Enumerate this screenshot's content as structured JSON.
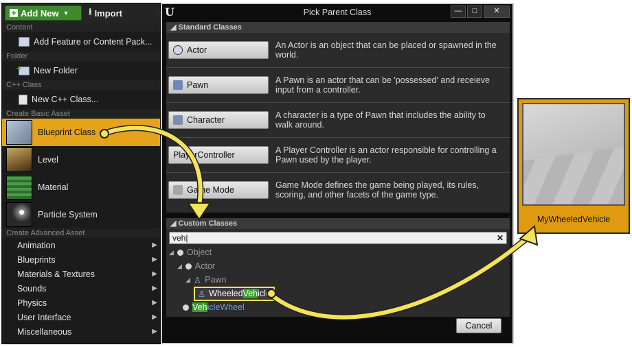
{
  "left_menu": {
    "add_new_label": "Add New",
    "import_label": "Import",
    "sections": {
      "content": "Content",
      "folder": "Folder",
      "cpp": "C++ Class",
      "basic": "Create Basic Asset",
      "advanced": "Create Advanced Asset"
    },
    "add_feature_label": "Add Feature or Content Pack...",
    "new_folder_label": "New Folder",
    "new_cpp_label": "New C++ Class...",
    "basic_assets": [
      {
        "label": "Blueprint Class",
        "icon": "blueprint-icon",
        "selected": true
      },
      {
        "label": "Level",
        "icon": "level-icon"
      },
      {
        "label": "Material",
        "icon": "material-icon"
      },
      {
        "label": "Particle System",
        "icon": "particle-icon"
      }
    ],
    "advanced_items": [
      "Animation",
      "Blueprints",
      "Materials & Textures",
      "Sounds",
      "Physics",
      "User Interface",
      "Miscellaneous"
    ]
  },
  "dialog": {
    "title": "Pick Parent Class",
    "window_buttons": [
      "—",
      "□",
      "✕"
    ],
    "standard_header": "Standard Classes",
    "standard_classes": [
      {
        "label": "Actor",
        "icon": "actor-icon",
        "desc": "An Actor is an object that can be placed or spawned in the world."
      },
      {
        "label": "Pawn",
        "icon": "pawn-icon",
        "desc": "A Pawn is an actor that can be 'possessed' and receieve input from a controller."
      },
      {
        "label": "Character",
        "icon": "character-icon",
        "desc": "A character is a type of Pawn that includes the ability to walk around."
      },
      {
        "label": "PlayerController",
        "icon": "controller-icon",
        "desc": "A Player Controller is an actor responsible for controlling a Pawn used by the player."
      },
      {
        "label": "Game Mode",
        "icon": "gamemode-icon",
        "desc": "Game Mode defines the game being played, its rules, scoring, and other facets of the game type."
      }
    ],
    "custom_header": "Custom Classes",
    "search_value": "veh|",
    "clear_glyph": "✕",
    "tree": {
      "object": "Object",
      "actor": "Actor",
      "pawn": "Pawn",
      "wheeled_pre": "Wheeled",
      "wheeled_hl": "Veh",
      "wheeled_post": "icle",
      "wheel_hl": "Veh",
      "wheel_post": "icleWheel"
    },
    "cancel_label": "Cancel"
  },
  "result_tile": {
    "label": "MyWheeledVehicle"
  },
  "colors": {
    "accent": "#e4a31a",
    "add_new_green": "#3c8a2b",
    "highlight_green": "#3a9d26",
    "arrow_yellow": "#f3e35a"
  }
}
